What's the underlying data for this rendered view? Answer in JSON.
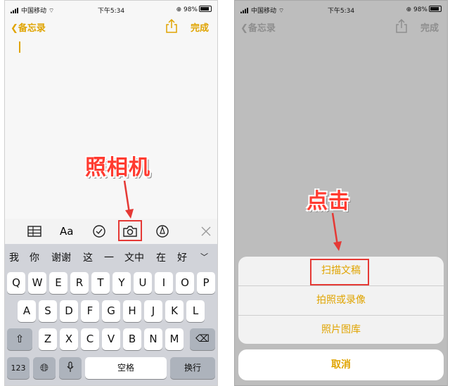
{
  "status": {
    "carrier": "中国移动",
    "time": "下午5:34",
    "battery": "98%"
  },
  "nav": {
    "back_label": "备忘录",
    "done_label": "完成"
  },
  "left": {
    "annotation": "照相机",
    "candidates": [
      "我",
      "你",
      "谢谢",
      "这",
      "一",
      "文中",
      "在",
      "好"
    ],
    "keyboard": {
      "row1": [
        "Q",
        "W",
        "E",
        "R",
        "T",
        "Y",
        "U",
        "I",
        "O",
        "P"
      ],
      "row2": [
        "A",
        "S",
        "D",
        "F",
        "G",
        "H",
        "J",
        "K",
        "L"
      ],
      "row3": [
        "Z",
        "X",
        "C",
        "V",
        "B",
        "N",
        "M"
      ],
      "numbers_label": "123",
      "space_label": "空格",
      "return_label": "换行"
    },
    "toolbar": {
      "format_label": "Aa"
    }
  },
  "right": {
    "annotation": "点击",
    "sheet": {
      "items": [
        "扫描文稿",
        "拍照或录像",
        "照片图库"
      ],
      "cancel_label": "取消"
    }
  },
  "colors": {
    "accent": "#e0a400",
    "annotation": "#ff3b30",
    "highlight_box": "#e53935"
  }
}
